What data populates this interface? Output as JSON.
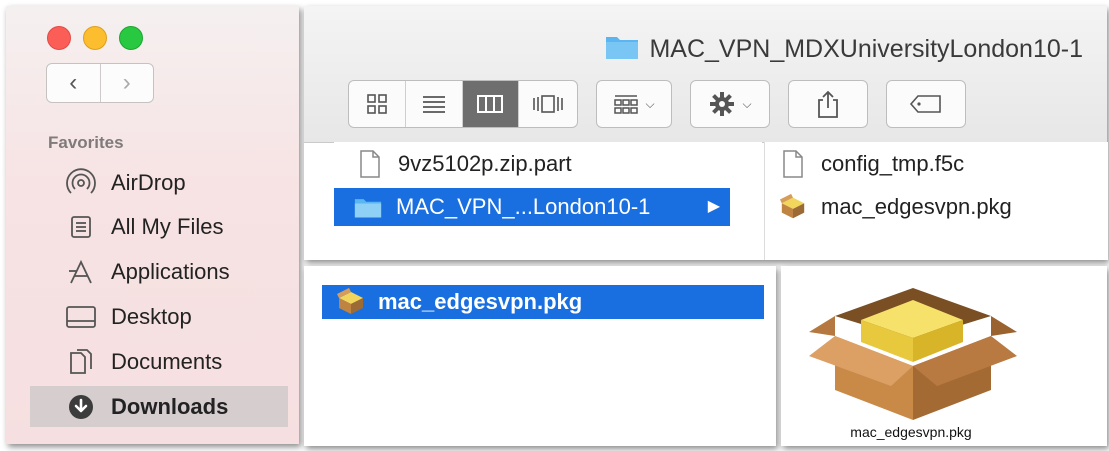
{
  "window": {
    "title": "MAC_VPN_MDXUniversityLondon10-1"
  },
  "sidebar": {
    "section_header": "Favorites",
    "items": [
      {
        "label": "AirDrop",
        "icon": "airdrop-icon"
      },
      {
        "label": "All My Files",
        "icon": "all-files-icon"
      },
      {
        "label": "Applications",
        "icon": "applications-icon"
      },
      {
        "label": "Desktop",
        "icon": "desktop-icon"
      },
      {
        "label": "Documents",
        "icon": "documents-icon"
      },
      {
        "label": "Downloads",
        "icon": "downloads-icon",
        "selected": true
      }
    ]
  },
  "toolbar": {
    "view_modes": [
      "icon-view",
      "list-view",
      "column-view",
      "cover-flow-view"
    ],
    "selected_view": "column-view",
    "buttons": [
      "arrange-menu",
      "action-menu",
      "share",
      "tags"
    ]
  },
  "columns": {
    "first": [
      {
        "name": "9vz5102p.zip.part",
        "type": "file"
      },
      {
        "name": "MAC_VPN_...London10-1",
        "type": "folder",
        "selected": true
      }
    ],
    "second": [
      {
        "name": "config_tmp.f5c",
        "type": "file"
      },
      {
        "name": "mac_edgesvpn.pkg",
        "type": "package"
      }
    ]
  },
  "selected_file": {
    "name": "mac_edgesvpn.pkg"
  },
  "preview": {
    "caption": "mac_edgesvpn.pkg"
  },
  "colors": {
    "selection_blue": "#1a6fe0",
    "folder_blue": "#5ab5f0",
    "traffic_red": "#fb5e57",
    "traffic_yellow": "#fcbd2e",
    "traffic_green": "#28c840"
  }
}
